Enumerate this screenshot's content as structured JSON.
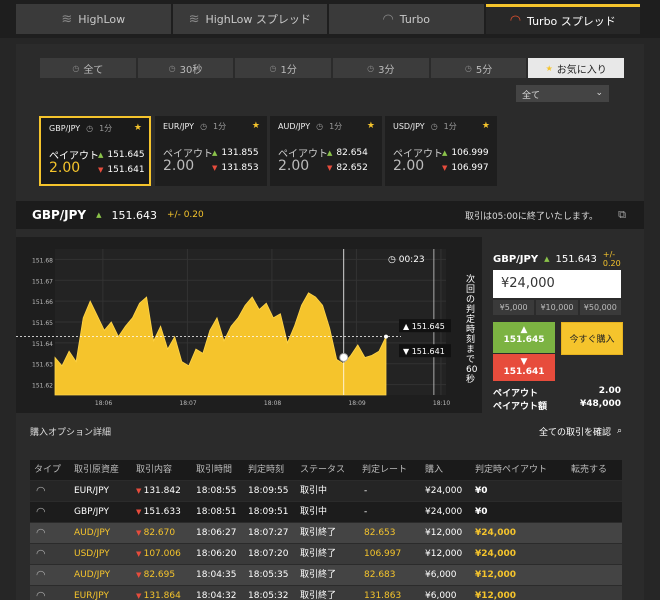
{
  "tabs": [
    {
      "label": "HighLow",
      "icon": "highlow-icon",
      "active": false
    },
    {
      "label": "HighLow スプレッド",
      "icon": "highlow-spread-icon",
      "active": false
    },
    {
      "label": "Turbo",
      "icon": "turbo-gauge-icon",
      "active": false
    },
    {
      "label": "Turbo スプレッド",
      "icon": "turbo-spread-gauge-icon",
      "active": true
    }
  ],
  "filters": [
    {
      "label": "全て",
      "icon": "clock-icon"
    },
    {
      "label": "30秒",
      "icon": "clock-icon"
    },
    {
      "label": "1分",
      "icon": "clock-icon"
    },
    {
      "label": "3分",
      "icon": "clock-icon"
    },
    {
      "label": "5分",
      "icon": "clock-icon"
    },
    {
      "label": "お気に入り",
      "icon": "star-icon",
      "selected": true
    }
  ],
  "select_value": "全て",
  "cards": [
    {
      "pair": "GBP/JPY",
      "time": "1分",
      "payout_label": "ペイアウト",
      "payout": "2.00",
      "up": "151.645",
      "down": "151.641",
      "selected": true
    },
    {
      "pair": "EUR/JPY",
      "time": "1分",
      "payout_label": "ペイアウト",
      "payout": "2.00",
      "up": "131.855",
      "down": "131.853"
    },
    {
      "pair": "AUD/JPY",
      "time": "1分",
      "payout_label": "ペイアウト",
      "payout": "2.00",
      "up": "82.654",
      "down": "82.652"
    },
    {
      "pair": "USD/JPY",
      "time": "1分",
      "payout_label": "ペイアウト",
      "payout": "2.00",
      "up": "106.999",
      "down": "106.997"
    }
  ],
  "pairbar": {
    "pair": "GBP/JPY",
    "price": "151.643",
    "change": "+/- 0.20",
    "note": "取引は05:00に終了いたします。"
  },
  "chart": {
    "countdown": "00:23",
    "vertical_label": "次回の判定時刻まで60秒",
    "ask_label": "151.645",
    "bid_label": "151.641"
  },
  "chart_data": {
    "type": "area",
    "yticks": [
      "151.68",
      "151.67",
      "151.66",
      "151.65",
      "151.64",
      "151.63",
      "151.62"
    ],
    "ylim": [
      151.615,
      151.685
    ],
    "xticks": [
      "18:06",
      "18:07",
      "18:08",
      "18:09",
      "18:10"
    ],
    "x": [
      "18:05:26",
      "18:05:31",
      "18:05:36",
      "18:05:41",
      "18:05:46",
      "18:05:51",
      "18:05:56",
      "18:06:01",
      "18:06:06",
      "18:06:11",
      "18:06:16",
      "18:06:21",
      "18:06:26",
      "18:06:31",
      "18:06:36",
      "18:06:41",
      "18:06:46",
      "18:06:51",
      "18:06:56",
      "18:07:01",
      "18:07:06",
      "18:07:11",
      "18:07:16",
      "18:07:21",
      "18:07:26",
      "18:07:31",
      "18:07:36",
      "18:07:41",
      "18:07:46",
      "18:07:51",
      "18:07:56",
      "18:08:01",
      "18:08:06",
      "18:08:11",
      "18:08:16",
      "18:08:21",
      "18:08:26",
      "18:08:31",
      "18:08:36",
      "18:08:41",
      "18:08:46",
      "18:08:51",
      "18:08:56",
      "18:09:01",
      "18:09:06",
      "18:09:11",
      "18:09:16",
      "18:09:21"
    ],
    "values": [
      151.633,
      151.629,
      151.636,
      151.631,
      151.652,
      151.66,
      151.653,
      151.646,
      151.65,
      151.643,
      151.648,
      151.652,
      151.659,
      151.662,
      151.641,
      151.648,
      151.637,
      151.643,
      151.631,
      151.629,
      151.637,
      151.635,
      151.646,
      151.652,
      151.641,
      151.648,
      151.652,
      151.658,
      151.662,
      151.656,
      151.659,
      151.652,
      151.654,
      151.64,
      151.648,
      151.658,
      151.664,
      151.662,
      151.658,
      151.647,
      151.632,
      151.63,
      151.634,
      151.639,
      151.633,
      151.634,
      151.636,
      151.643
    ],
    "series": [
      {
        "values": []
      }
    ],
    "entry_time": "18:09",
    "current_price": 151.643,
    "color": "#f5c42c"
  },
  "trade": {
    "pair": "GBP/JPY",
    "price": "151.643",
    "change": "+/- 0.20",
    "amount": "¥24,000",
    "quick": [
      "¥5,000",
      "¥10,000",
      "¥50,000"
    ],
    "up_price": "151.645",
    "down_price": "151.641",
    "buy_now": "今すぐ購入",
    "payout_label": "ペイアウト",
    "payout_value": "2.00",
    "payout_amount_label": "ペイアウト額",
    "payout_amount_value": "¥48,000"
  },
  "detail": {
    "title": "購入オプション詳細",
    "link": "全ての取引を確認"
  },
  "table": {
    "headers": [
      "タイプ",
      "取引原資産",
      "取引内容",
      "取引時間",
      "判定時刻",
      "ステータス",
      "判定レート",
      "購入",
      "判定時ペイアウト",
      "転売する"
    ],
    "rows": [
      {
        "asset": "EUR/JPY",
        "dir": "down",
        "rate": "131.842",
        "time": "18:08:55",
        "judge": "18:09:55",
        "status": "取引中",
        "jrate": "-",
        "buy": "¥24,000",
        "pay": "¥0",
        "done": false
      },
      {
        "asset": "GBP/JPY",
        "dir": "down",
        "rate": "151.633",
        "time": "18:08:51",
        "judge": "18:09:51",
        "status": "取引中",
        "jrate": "-",
        "buy": "¥24,000",
        "pay": "¥0",
        "done": false
      },
      {
        "asset": "AUD/JPY",
        "dir": "down",
        "rate": "82.670",
        "time": "18:06:27",
        "judge": "18:07:27",
        "status": "取引終了",
        "jrate": "82.653",
        "buy": "¥12,000",
        "pay": "¥24,000",
        "done": true
      },
      {
        "asset": "USD/JPY",
        "dir": "down",
        "rate": "107.006",
        "time": "18:06:20",
        "judge": "18:07:20",
        "status": "取引終了",
        "jrate": "106.997",
        "buy": "¥12,000",
        "pay": "¥24,000",
        "done": true
      },
      {
        "asset": "AUD/JPY",
        "dir": "down",
        "rate": "82.695",
        "time": "18:04:35",
        "judge": "18:05:35",
        "status": "取引終了",
        "jrate": "82.683",
        "buy": "¥6,000",
        "pay": "¥12,000",
        "done": true
      },
      {
        "asset": "EUR/JPY",
        "dir": "down",
        "rate": "131.864",
        "time": "18:04:32",
        "judge": "18:05:32",
        "status": "取引終了",
        "jrate": "131.863",
        "buy": "¥6,000",
        "pay": "¥12,000",
        "done": true
      }
    ]
  }
}
